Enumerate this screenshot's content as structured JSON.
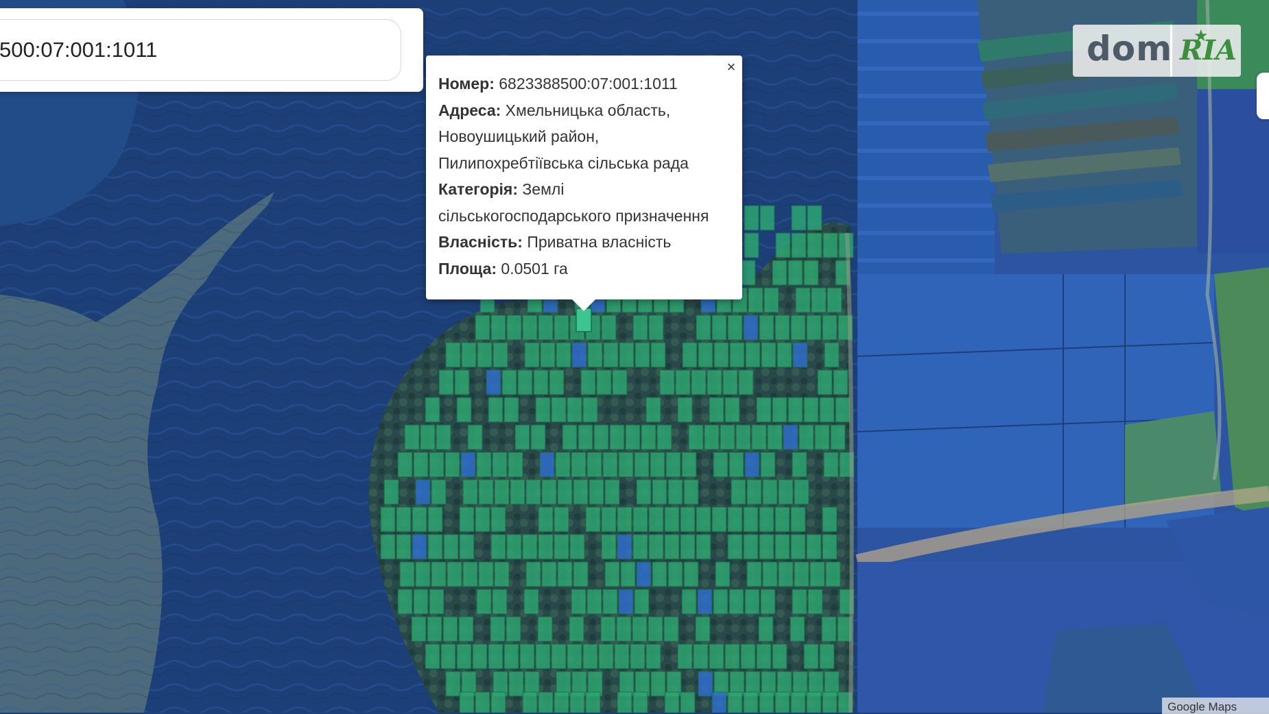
{
  "search": {
    "value": "500:07:001:1011"
  },
  "popup": {
    "close_label": "×",
    "number_label": "Номер:",
    "number_value": "6823388500:07:001:1011",
    "address_label": "Адреса:",
    "address_line1": "Хмельницька область,",
    "address_line2": "Новоушицький район,",
    "address_line3": "Пилипохребтіївська сільська рада",
    "category_label": "Категорія:",
    "category_line1": "Землі",
    "category_line2": "сільськогосподарського призначення",
    "ownership_label": "Власність:",
    "ownership_value": "Приватна власність",
    "area_label": "Площа:",
    "area_value": "0.0501 га"
  },
  "logo": {
    "dom": "dom",
    "ria": "RIA"
  },
  "attribution": "Google Maps",
  "colors": {
    "parcel_green": "#2ea872",
    "parcel_blue": "#2f6fcf",
    "water": "#1d3f78",
    "selected_parcel": "#3cc590"
  },
  "icons": {
    "close": "close-icon",
    "logo_star": "star-icon"
  }
}
